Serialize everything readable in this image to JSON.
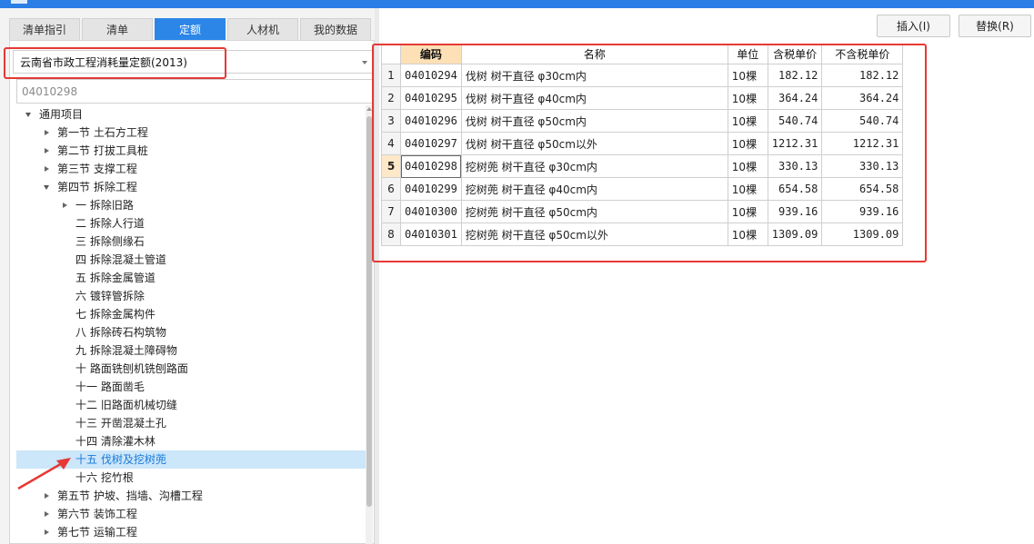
{
  "tabs": [
    {
      "label": "清单指引",
      "active": false
    },
    {
      "label": "清单",
      "active": false
    },
    {
      "label": "定额",
      "active": true
    },
    {
      "label": "人材机",
      "active": false
    },
    {
      "label": "我的数据",
      "active": false
    }
  ],
  "library_select": {
    "value": "云南省市政工程消耗量定额(2013)"
  },
  "search": {
    "value": "04010298"
  },
  "tree": [
    {
      "label": "通用项目",
      "level": 0,
      "state": "expanded"
    },
    {
      "label": "第一节 土石方工程",
      "level": 1,
      "state": "collapsed"
    },
    {
      "label": "第二节 打拔工具桩",
      "level": 1,
      "state": "collapsed"
    },
    {
      "label": "第三节 支撑工程",
      "level": 1,
      "state": "collapsed"
    },
    {
      "label": "第四节 拆除工程",
      "level": 1,
      "state": "expanded"
    },
    {
      "label": "一 拆除旧路",
      "level": 2,
      "state": "collapsed"
    },
    {
      "label": "二 拆除人行道",
      "level": 2,
      "state": "leaf"
    },
    {
      "label": "三 拆除侧缘石",
      "level": 2,
      "state": "leaf"
    },
    {
      "label": "四 拆除混凝土管道",
      "level": 2,
      "state": "leaf"
    },
    {
      "label": "五 拆除金属管道",
      "level": 2,
      "state": "leaf"
    },
    {
      "label": "六 镀锌管拆除",
      "level": 2,
      "state": "leaf"
    },
    {
      "label": "七 拆除金属构件",
      "level": 2,
      "state": "leaf"
    },
    {
      "label": "八 拆除砖石构筑物",
      "level": 2,
      "state": "leaf"
    },
    {
      "label": "九 拆除混凝土障碍物",
      "level": 2,
      "state": "leaf"
    },
    {
      "label": "十 路面铣刨机铣刨路面",
      "level": 2,
      "state": "leaf"
    },
    {
      "label": "十一 路面凿毛",
      "level": 2,
      "state": "leaf"
    },
    {
      "label": "十二 旧路面机械切缝",
      "level": 2,
      "state": "leaf"
    },
    {
      "label": "十三 开凿混凝土孔",
      "level": 2,
      "state": "leaf"
    },
    {
      "label": "十四 清除灌木林",
      "level": 2,
      "state": "leaf"
    },
    {
      "label": "十五 伐树及挖树蔸",
      "level": 2,
      "state": "leaf",
      "selected": true
    },
    {
      "label": "十六 挖竹根",
      "level": 2,
      "state": "leaf"
    },
    {
      "label": "第五节 护坡、挡墙、沟槽工程",
      "level": 1,
      "state": "collapsed"
    },
    {
      "label": "第六节 装饰工程",
      "level": 1,
      "state": "collapsed"
    },
    {
      "label": "第七节 运输工程",
      "level": 1,
      "state": "collapsed"
    }
  ],
  "buttons": {
    "insert": "插入(I)",
    "replace": "替换(R)"
  },
  "table": {
    "headers": [
      "编码",
      "名称",
      "单位",
      "含税单价",
      "不含税单价"
    ],
    "current_row": 5,
    "rows": [
      {
        "no": "1",
        "code": "04010294",
        "name": "伐树 树干直径 φ30cm内",
        "unit": "10棵",
        "price_tax": "182.12",
        "price_notax": "182.12"
      },
      {
        "no": "2",
        "code": "04010295",
        "name": "伐树 树干直径 φ40cm内",
        "unit": "10棵",
        "price_tax": "364.24",
        "price_notax": "364.24"
      },
      {
        "no": "3",
        "code": "04010296",
        "name": "伐树 树干直径 φ50cm内",
        "unit": "10棵",
        "price_tax": "540.74",
        "price_notax": "540.74"
      },
      {
        "no": "4",
        "code": "04010297",
        "name": "伐树 树干直径 φ50cm以外",
        "unit": "10棵",
        "price_tax": "1212.31",
        "price_notax": "1212.31"
      },
      {
        "no": "5",
        "code": "04010298",
        "name": "挖树蔸 树干直径 φ30cm内",
        "unit": "10棵",
        "price_tax": "330.13",
        "price_notax": "330.13"
      },
      {
        "no": "6",
        "code": "04010299",
        "name": "挖树蔸 树干直径 φ40cm内",
        "unit": "10棵",
        "price_tax": "654.58",
        "price_notax": "654.58"
      },
      {
        "no": "7",
        "code": "04010300",
        "name": "挖树蔸 树干直径 φ50cm内",
        "unit": "10棵",
        "price_tax": "939.16",
        "price_notax": "939.16"
      },
      {
        "no": "8",
        "code": "04010301",
        "name": "挖树蔸 树干直径 φ50cm以外",
        "unit": "10棵",
        "price_tax": "1309.09",
        "price_notax": "1309.09"
      }
    ]
  },
  "colors": {
    "accent": "#2b86e8",
    "header_highlight": "#fde0b5",
    "selection": "#cce6fa",
    "annotation": "#e53935"
  }
}
